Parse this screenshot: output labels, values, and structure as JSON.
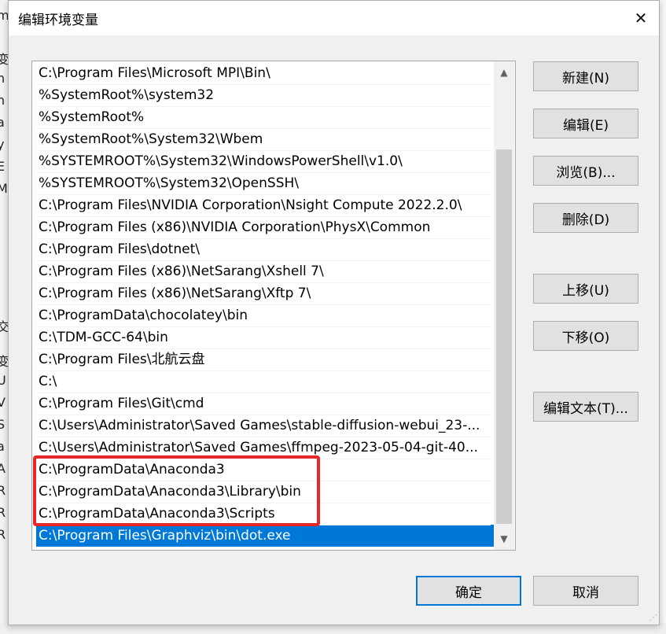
{
  "dialog": {
    "title": "编辑环境变量",
    "close_glyph": "✕"
  },
  "background": {
    "chars": [
      "m",
      "变",
      "h",
      "n",
      "a",
      "y",
      "E",
      "M",
      "交",
      "变",
      "U",
      "V",
      "S",
      "a",
      "A",
      "R",
      "R",
      "R"
    ]
  },
  "path_list": {
    "items": [
      {
        "text": "C:\\Program Files\\Microsoft MPI\\Bin\\"
      },
      {
        "text": "%SystemRoot%\\system32"
      },
      {
        "text": "%SystemRoot%"
      },
      {
        "text": "%SystemRoot%\\System32\\Wbem"
      },
      {
        "text": "%SYSTEMROOT%\\System32\\WindowsPowerShell\\v1.0\\"
      },
      {
        "text": "%SYSTEMROOT%\\System32\\OpenSSH\\"
      },
      {
        "text": "C:\\Program Files\\NVIDIA Corporation\\Nsight Compute 2022.2.0\\"
      },
      {
        "text": "C:\\Program Files (x86)\\NVIDIA Corporation\\PhysX\\Common"
      },
      {
        "text": "C:\\Program Files\\dotnet\\"
      },
      {
        "text": "C:\\Program Files (x86)\\NetSarang\\Xshell 7\\"
      },
      {
        "text": "C:\\Program Files (x86)\\NetSarang\\Xftp 7\\"
      },
      {
        "text": "C:\\ProgramData\\chocolatey\\bin"
      },
      {
        "text": "C:\\TDM-GCC-64\\bin"
      },
      {
        "text": "C:\\Program Files\\北航云盘"
      },
      {
        "text": "C:\\"
      },
      {
        "text": "C:\\Program Files\\Git\\cmd"
      },
      {
        "text": "C:\\Users\\Administrator\\Saved Games\\stable-diffusion-webui_23-..."
      },
      {
        "text": "C:\\Users\\Administrator\\Saved Games\\ffmpeg-2023-05-04-git-40..."
      },
      {
        "text": "C:\\ProgramData\\Anaconda3"
      },
      {
        "text": "C:\\ProgramData\\Anaconda3\\Library\\bin"
      },
      {
        "text": "C:\\ProgramData\\Anaconda3\\Scripts"
      },
      {
        "text": "C:\\Program Files\\Graphviz\\bin\\dot.exe"
      }
    ],
    "selected_index": 21,
    "highlighted_indices": [
      18,
      19,
      20
    ],
    "highlight_color": "#e82828",
    "selection_color": "#0078d7",
    "scroll_up_icon": "▲",
    "scroll_down_icon": "▼"
  },
  "buttons": {
    "new": "新建(N)",
    "edit": "编辑(E)",
    "browse": "浏览(B)...",
    "delete": "删除(D)",
    "move_up": "上移(U)",
    "move_down": "下移(O)",
    "edit_text": "编辑文本(T)...",
    "ok": "确定",
    "cancel": "取消"
  }
}
